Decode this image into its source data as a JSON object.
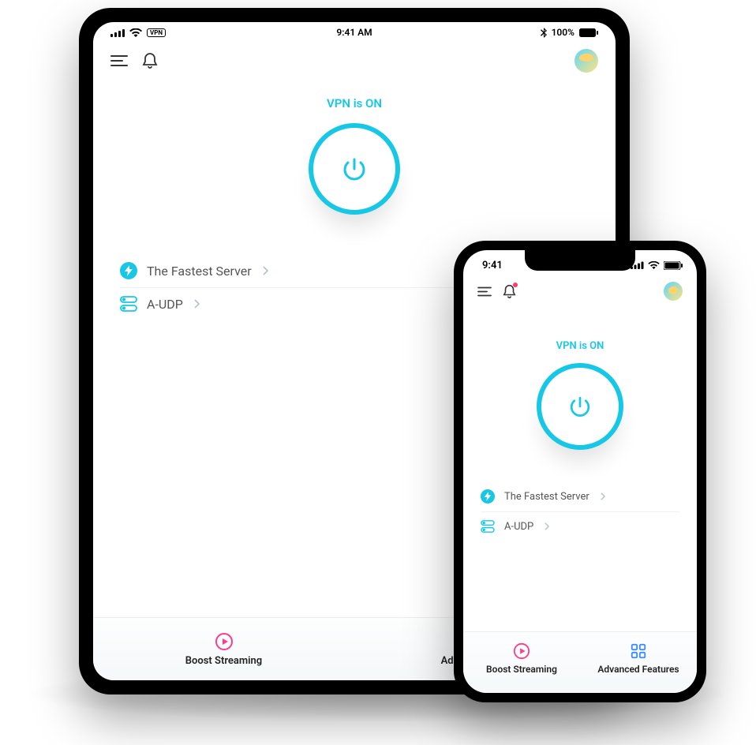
{
  "ipad": {
    "status": {
      "time": "9:41 AM",
      "battery": "100%"
    },
    "header": {},
    "main": {
      "vpn_status": "VPN is ON",
      "server_row": "The Fastest Server",
      "protocol_row": "A-UDP"
    },
    "bottom": {
      "tab1": "Boost Streaming",
      "tab2": "Advanced Features"
    }
  },
  "iphone": {
    "status": {
      "time": "9:41"
    },
    "main": {
      "vpn_status": "VPN is ON",
      "server_row": "The Fastest Server",
      "protocol_row": "A-UDP"
    },
    "bottom": {
      "tab1": "Boost Streaming",
      "tab2": "Advanced Features"
    }
  },
  "colors": {
    "accent": "#17c7e6",
    "pink": "#ff3b8d",
    "blue2": "#3a8dff"
  }
}
